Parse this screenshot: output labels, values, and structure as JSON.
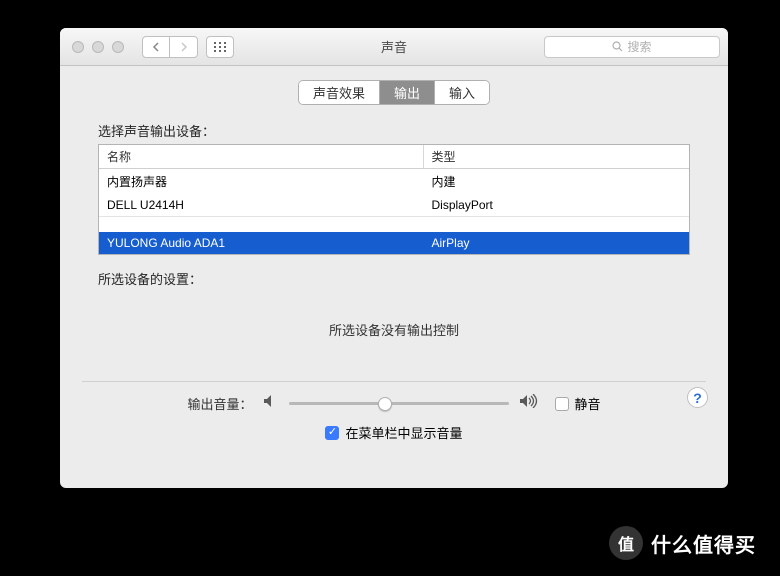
{
  "window": {
    "title": "声音"
  },
  "search": {
    "placeholder": "搜索"
  },
  "tabs": {
    "effects": "声音效果",
    "output": "输出",
    "input": "输入",
    "active": "output"
  },
  "output_section": {
    "choose_label": "选择声音输出设备：",
    "columns": {
      "name": "名称",
      "type": "类型"
    },
    "devices": [
      {
        "name": "内置扬声器",
        "type": "内建",
        "selected": false
      },
      {
        "name": "DELL U2414H",
        "type": "DisplayPort",
        "selected": false
      },
      {
        "name": "YULONG Audio ADA1",
        "type": "AirPlay",
        "selected": true
      }
    ],
    "settings_label": "所选设备的设置：",
    "no_control_text": "所选设备没有输出控制"
  },
  "volume": {
    "label": "输出音量：",
    "mute_label": "静音",
    "muted": false,
    "value_percent": 44,
    "show_in_menubar_label": "在菜单栏中显示音量",
    "show_in_menubar": true
  },
  "watermark": {
    "badge": "值",
    "text": "什么值得买"
  }
}
